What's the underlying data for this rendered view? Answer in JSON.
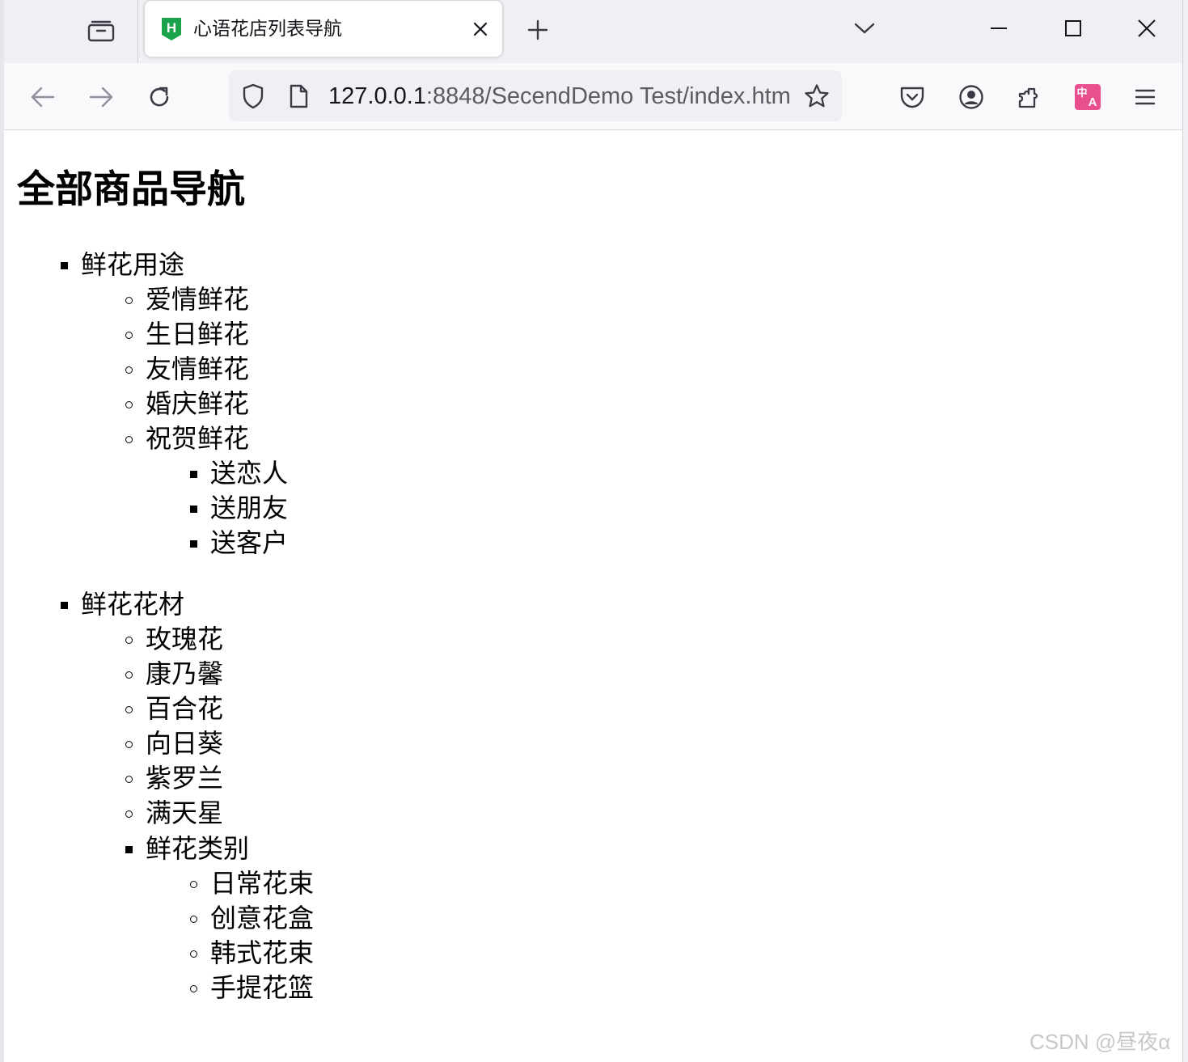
{
  "browser": {
    "tab_title": "心语花店列表导航",
    "url_host": "127.0.0.1",
    "url_rest": ":8848/SecendDemo Test/index.htm",
    "icons": [
      "tabs-list-icon",
      "html-favicon-icon",
      "close-icon",
      "plus-icon",
      "chevron-down-icon",
      "minimize-icon",
      "maximize-icon",
      "window-close-icon",
      "back-arrow-icon",
      "forward-arrow-icon",
      "reload-icon",
      "shield-icon",
      "page-icon",
      "star-icon",
      "pocket-icon",
      "account-icon",
      "extensions-icon",
      "translate-icon",
      "menu-icon"
    ],
    "favicon_color": "#1aa34a",
    "translate_color": "#e94f8c"
  },
  "page": {
    "title": "全部商品导航",
    "groups": [
      {
        "label": "鲜花用途",
        "items": [
          "爱情鲜花",
          "生日鲜花",
          "友情鲜花",
          "婚庆鲜花",
          "祝贺鲜花"
        ],
        "sub_items": [
          "送恋人",
          "送朋友",
          "送客户"
        ]
      },
      {
        "label": "鲜花花材",
        "items": [
          "玫瑰花",
          "康乃馨",
          "百合花",
          "向日葵",
          "紫罗兰",
          "满天星"
        ],
        "sub_label": "鲜花类别",
        "sub_items": [
          "日常花束",
          "创意花盒",
          "韩式花束",
          "手提花篮"
        ]
      }
    ]
  },
  "watermark": "CSDN @昼夜α"
}
